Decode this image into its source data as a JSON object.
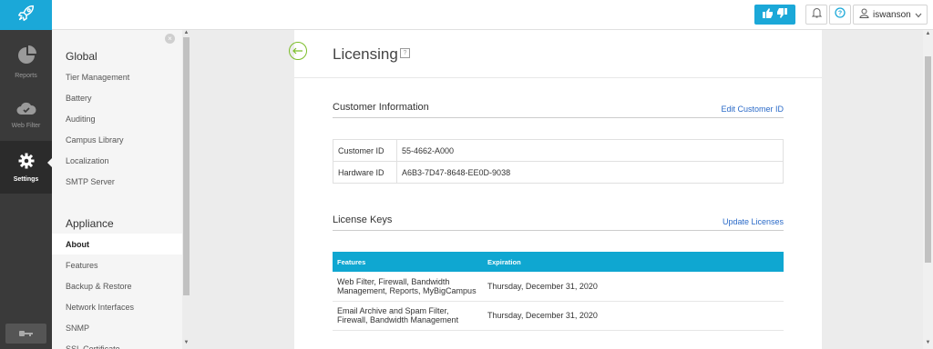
{
  "topbar": {
    "user_name": "iswanson",
    "colors": {
      "brand": "#1ba8d8"
    },
    "icons": [
      "rocket-icon",
      "thumbs-up-icon",
      "thumbs-down-icon",
      "bell-icon",
      "question-icon",
      "user-icon",
      "chevron-down-icon"
    ]
  },
  "leftnav": {
    "items": [
      {
        "label": "Reports",
        "icon": "pie-chart-icon"
      },
      {
        "label": "Web Filter",
        "icon": "cloud-filter-icon"
      },
      {
        "label": "Settings",
        "icon": "gear-icon",
        "active": true
      }
    ]
  },
  "settings": {
    "global_title": "Global",
    "global_items": [
      "Tier Management",
      "Battery",
      "Auditing",
      "Campus Library",
      "Localization",
      "SMTP Server"
    ],
    "appliance_title": "Appliance",
    "appliance_items": [
      "About",
      "Features",
      "Backup & Restore",
      "Network Interfaces",
      "SNMP",
      "SSL Certificate"
    ],
    "active_item": "About"
  },
  "main": {
    "title": "Licensing",
    "help_label": "?",
    "customer": {
      "title": "Customer Information",
      "edit_link": "Edit Customer ID",
      "rows": [
        {
          "label": "Customer ID",
          "value": "55-4662-A000"
        },
        {
          "label": "Hardware ID",
          "value": "A6B3-7D47-8648-EE0D-9038"
        }
      ]
    },
    "licenses": {
      "title": "License Keys",
      "update_link": "Update Licenses",
      "headers": [
        "Features",
        "Expiration"
      ],
      "rows": [
        {
          "features": "Web Filter, Firewall, Bandwidth Management, Reports, MyBigCampus",
          "expiration": "Thursday, December 31, 2020"
        },
        {
          "features": "Email Archive and Spam Filter, Firewall, Bandwidth Management",
          "expiration": "Thursday, December 31, 2020"
        }
      ],
      "header_color": "#0fa7d1"
    }
  }
}
